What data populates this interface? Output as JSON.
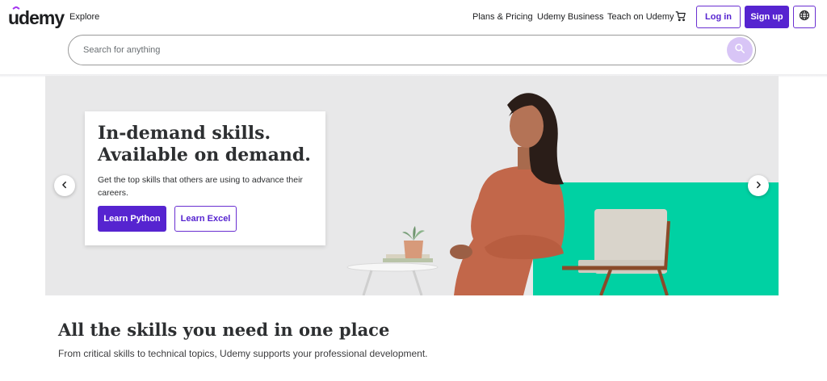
{
  "header": {
    "logo_text": "udemy",
    "explore_label": "Explore",
    "nav": {
      "plans_label": "Plans & Pricing",
      "business_label": "Udemy Business",
      "teach_label": "Teach on Udemy"
    },
    "cart_icon": "shopping-cart-icon",
    "login_label": "Log in",
    "signup_label": "Sign up",
    "globe_icon": "globe-icon"
  },
  "search": {
    "placeholder": "Search for anything",
    "value": "",
    "icon": "search-icon"
  },
  "hero": {
    "title_line1": "In-demand skills.",
    "title_line2": "Available on demand.",
    "description": "Get the top skills that others are using to advance their careers.",
    "primary_button": "Learn Python",
    "secondary_button": "Learn Excel",
    "prev_icon": "chevron-left-icon",
    "next_icon": "chevron-right-icon"
  },
  "section": {
    "title": "All the skills you need in one place",
    "subtitle": "From critical skills to technical topics, Udemy supports your professional development."
  },
  "colors": {
    "brand_purple": "#5624d0",
    "search_button": "#d8c5f6",
    "hero_background": "#e8e8e9",
    "teal_accent": "#00d1a3",
    "text_dark": "#2d2f31"
  }
}
